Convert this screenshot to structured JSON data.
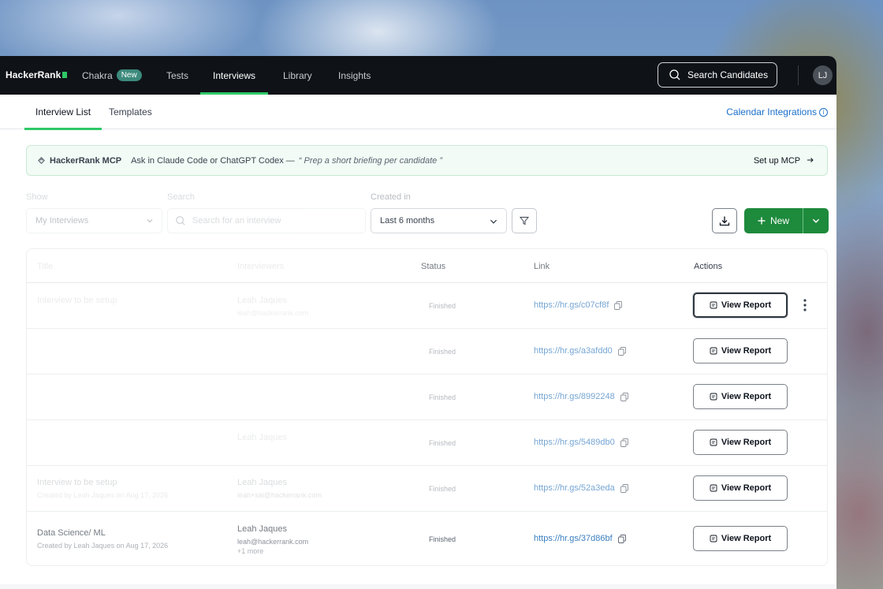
{
  "brand": "HackerRank",
  "nav": {
    "items": [
      {
        "label": "Chakra",
        "badge": "New"
      },
      {
        "label": "Tests"
      },
      {
        "label": "Interviews",
        "active": true
      },
      {
        "label": "Library"
      },
      {
        "label": "Insights"
      }
    ],
    "search_label": "Search Candidates",
    "avatar_initials": "LJ"
  },
  "subtabs": {
    "items": [
      "Interview List",
      "Templates"
    ],
    "active": "Interview List",
    "calendar_link": "Calendar Integrations"
  },
  "mcp_banner": {
    "title": "HackerRank MCP",
    "prompt": "Ask in Claude Code or ChatGPT Codex —",
    "quote": "“ Prep a short briefing per candidate ”",
    "action": "Set up MCP"
  },
  "filters": {
    "show_label": "Show",
    "show_value": "My Interviews",
    "search_label": "Search",
    "search_placeholder": "Search for an interview",
    "created_label": "Created in",
    "created_value": "Last 6 months"
  },
  "new_button": "New",
  "table": {
    "columns": [
      "Title",
      "Interviewers",
      "Status",
      "Link",
      "Actions"
    ],
    "rows": [
      {
        "title": "Interview to be setup",
        "subtitle": "",
        "interviewer": "Leah Jaques",
        "email": "leah@hackerrank.com",
        "more": "",
        "status": "Finished",
        "link": "https://hr.gs/c07cf8f",
        "action": "View Report"
      },
      {
        "title": "",
        "subtitle": "",
        "interviewer": "",
        "email": "",
        "more": "",
        "status": "Finished",
        "link": "https://hr.gs/a3afdd0",
        "action": "View Report"
      },
      {
        "title": "",
        "subtitle": "",
        "interviewer": "",
        "email": "",
        "more": "",
        "status": "Finished",
        "link": "https://hr.gs/8992248",
        "action": "View Report"
      },
      {
        "title": "",
        "subtitle": "",
        "interviewer": "Leah Jaques",
        "email": "",
        "more": "",
        "status": "Finished",
        "link": "https://hr.gs/5489db0",
        "action": "View Report"
      },
      {
        "title": "Interview to be setup",
        "subtitle": "Created by Leah Jaques on Aug 17, 2026",
        "interviewer": "Leah Jaques",
        "email": "leah+sai@hackerrank.com",
        "more": "",
        "status": "Finished",
        "link": "https://hr.gs/52a3eda",
        "action": "View Report"
      },
      {
        "title": "Data Science/ ML",
        "subtitle": "Created by Leah Jaques on Aug 17, 2026",
        "interviewer": "Leah Jaques",
        "email": "leah@hackerrank.com",
        "more": "+1 more",
        "status": "Finished",
        "link": "https://hr.gs/37d86bf",
        "action": "View Report"
      }
    ]
  },
  "colors": {
    "nav_bg": "#0f1318",
    "accent_green": "#2ec866",
    "primary_button": "#1e8a3c",
    "link_blue": "#3a7fc1"
  },
  "icons": [
    "search-icon",
    "mcp-icon",
    "arrow-right-icon",
    "chevron-down-icon",
    "filter-icon",
    "download-icon",
    "plus-icon",
    "copy-icon",
    "report-icon",
    "kebab-icon",
    "info-icon"
  ]
}
